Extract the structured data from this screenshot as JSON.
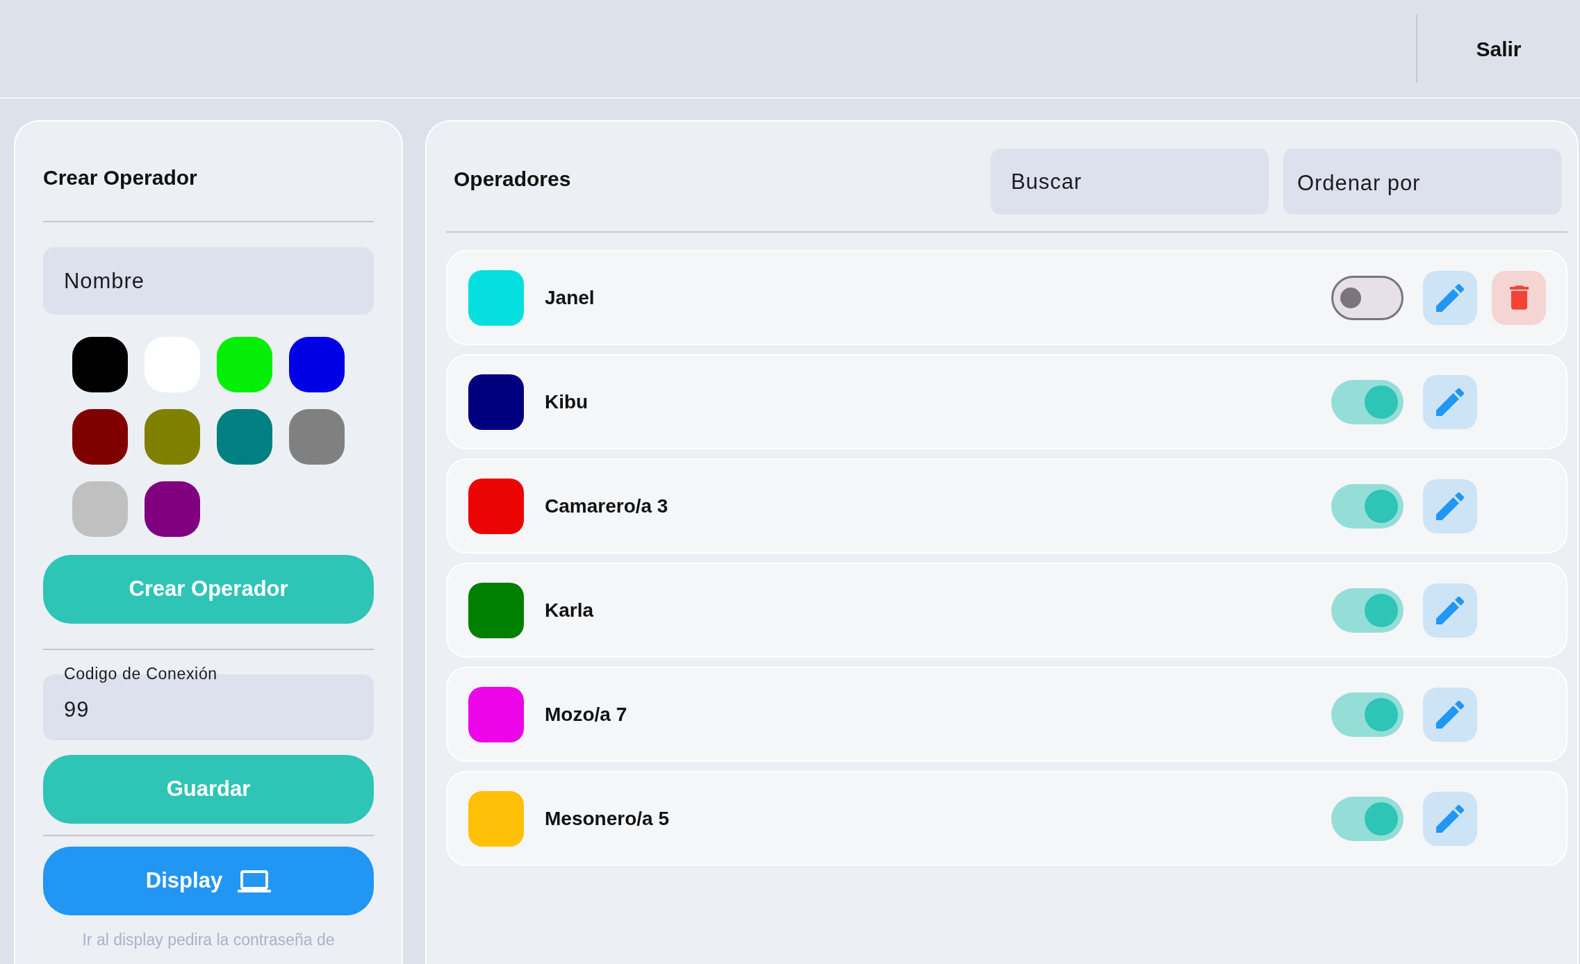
{
  "top_bar": {
    "logout": "Salir"
  },
  "create_panel": {
    "title": "Crear Operador",
    "name_field": {
      "placeholder": "Nombre"
    },
    "palette": [
      {
        "color": "#000000"
      },
      {
        "color": "#ffffff"
      },
      {
        "color": "#05ee05"
      },
      {
        "color": "#0000e4"
      },
      {
        "color": "#800000"
      },
      {
        "color": "#808000"
      },
      {
        "color": "#008080"
      },
      {
        "color": "#808080"
      },
      {
        "color": "#c0c0c0"
      },
      {
        "color": "#800080"
      }
    ],
    "create_button": "Crear Operador",
    "connection_code": {
      "label": "Codigo de Conexión",
      "value": "99"
    },
    "save_button": "Guardar",
    "display_button": "Display",
    "hint": "Ir al display pedira la contraseña de"
  },
  "operators_panel": {
    "title": "Operadores",
    "search": {
      "placeholder": "Buscar"
    },
    "sort": {
      "label": "Ordenar por"
    },
    "rows": [
      {
        "name": "Janel",
        "color": "#06dfe0",
        "on": false,
        "actions": [
          {
            "kind": "edit"
          },
          {
            "kind": "delete"
          }
        ]
      },
      {
        "name": "Kibu",
        "color": "#00007f",
        "on": true,
        "actions": [
          {
            "kind": "edit"
          }
        ]
      },
      {
        "name": "Camarero/a 3",
        "color": "#ec0303",
        "on": true,
        "actions": [
          {
            "kind": "edit"
          }
        ]
      },
      {
        "name": "Karla",
        "color": "#008000",
        "on": true,
        "actions": [
          {
            "kind": "edit"
          }
        ]
      },
      {
        "name": "Mozo/a 7",
        "color": "#eb05e8",
        "on": true,
        "actions": [
          {
            "kind": "edit"
          }
        ]
      },
      {
        "name": "Mesonero/a 5",
        "color": "#ffc107",
        "on": true,
        "actions": [
          {
            "kind": "edit"
          }
        ]
      }
    ]
  }
}
